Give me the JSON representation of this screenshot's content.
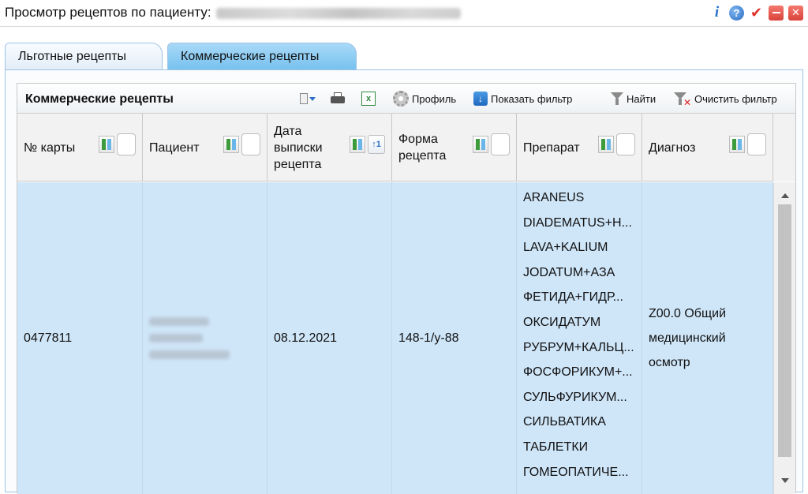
{
  "window": {
    "title": "Просмотр рецептов по пациенту:",
    "icons": [
      "info-icon",
      "help-icon",
      "check-icon",
      "minimize-icon",
      "close-icon"
    ]
  },
  "tabs": [
    {
      "label": "Льготные рецепты",
      "active": false
    },
    {
      "label": "Коммерческие рецепты",
      "active": true
    }
  ],
  "toolbar": {
    "title": "Коммерческие рецепты",
    "profile_label": "Профиль",
    "show_filter_label": "Показать фильтр",
    "find_label": "Найти",
    "clear_filter_label": "Очистить фильтр"
  },
  "columns": [
    {
      "label": "№ карты"
    },
    {
      "label": "Пациент"
    },
    {
      "label": "Дата выписки рецепта"
    },
    {
      "label": "Форма рецепта"
    },
    {
      "label": "Препарат"
    },
    {
      "label": "Диагноз"
    }
  ],
  "row": {
    "card_number": "0477811",
    "date": "08.12.2021",
    "form": "148-1/у-88",
    "drugs": [
      "ARANEUS",
      "DIADEMATUS+H...",
      "LAVA+KALIUM",
      "JODATUM+АЗА",
      "ФЕТИДА+ГИДР...",
      "ОКСИДАТУМ",
      "РУБРУМ+КАЛЬЦ...",
      "ФОСФОРИКУМ+...",
      "СУЛЬФУРИКУМ...",
      "СИЛЬВАТИКА",
      "ТАБЛЕТКИ",
      "ГОМЕОПАТИЧЕ..."
    ],
    "diagnosis": [
      "Z00.0 Общий",
      "медицинский",
      "осмотр"
    ]
  },
  "colors": {
    "selected_row": "#cfe6f9",
    "active_tab": "#8fcdf3",
    "header_bg": "#f2f2f2"
  }
}
